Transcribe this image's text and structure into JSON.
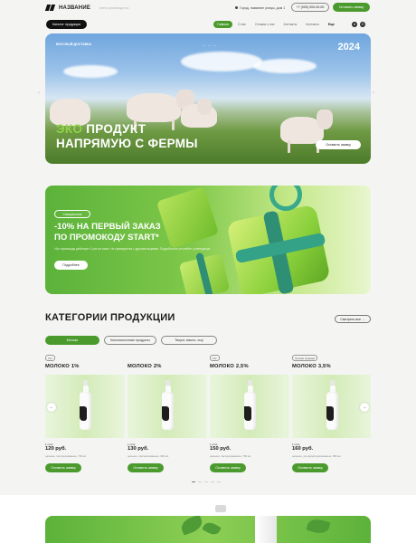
{
  "header": {
    "logo_name": "НАЗВАНИЕ",
    "tagline": "мини-производство",
    "address": "Город, название улицы, дом 1",
    "phone": "+7 (000) 000-00-00",
    "order_button": "Оставить заявку"
  },
  "nav": {
    "catalog_button": "Каталог продукции",
    "links": [
      {
        "label": "Главная",
        "active": true
      },
      {
        "label": "О нас",
        "active": false
      },
      {
        "label": "Отзывы о нас",
        "active": false
      },
      {
        "label": "Контакты",
        "active": false
      },
      {
        "label": "Контакты",
        "active": false
      },
      {
        "label": "Еще",
        "active": false
      }
    ],
    "socials": [
      "telegram-icon",
      "whatsapp-icon"
    ]
  },
  "hero": {
    "brand": "ВКУСНЫЙ ДОСТАВКА",
    "year": "2024",
    "title_accent": "ЭКО",
    "title_rest": " ПРОДУКТ",
    "title_line2": "НАПРЯМУЮ С ФЕРМЫ",
    "button": "Оставить заявку"
  },
  "promo": {
    "badge": "Специальное",
    "title_line1": "-10% НА ПЕРВЫЙ ЗАКАЗ",
    "title_line2": "ПО ПРОМОКОДУ START*",
    "description": "*Акт промокода действует 1 раз на заказ. Не суммируется с другими акциями. Подробности уточняйте у менеджера",
    "button": "Подробнее"
  },
  "categories": {
    "title": "КАТЕГОРИИ ПРОДУКЦИИ",
    "all_button": "Смотреть все",
    "filters": [
      {
        "label": "Молоко",
        "active": true
      },
      {
        "label": "Кисломолочные продукты",
        "active": false
      },
      {
        "label": "Творог, масло, сыр",
        "active": false
      }
    ]
  },
  "products": [
    {
      "badge": "Хит",
      "name": "МОЛОКО 1%",
      "unit": "1 литр",
      "price": "120 руб.",
      "desc": "цельное, пастеризованное, 750 мл",
      "button": "Оставить заявку"
    },
    {
      "badge": "",
      "name": "МОЛОКО 2%",
      "unit": "1 литр",
      "price": "130 руб.",
      "desc": "цельное, пастеризованное, 900 мл",
      "button": "Оставить заявку"
    },
    {
      "badge": "Хит",
      "name": "МОЛОКО 2,5%",
      "unit": "1 литр",
      "price": "150 руб.",
      "desc": "цельное, пастеризованное, 750 мл",
      "button": "Оставить заявку"
    },
    {
      "badge": "Лучшая продажа",
      "name": "МОЛОКО 3,5%",
      "unit": "1 литр",
      "price": "160 руб.",
      "desc": "цельное, ультрапастеризованное, 950 мл",
      "button": "Оставить заявку"
    }
  ],
  "colors": {
    "accent": "#4b9a2d",
    "light_green": "#8ed346",
    "dark": "#111111"
  }
}
